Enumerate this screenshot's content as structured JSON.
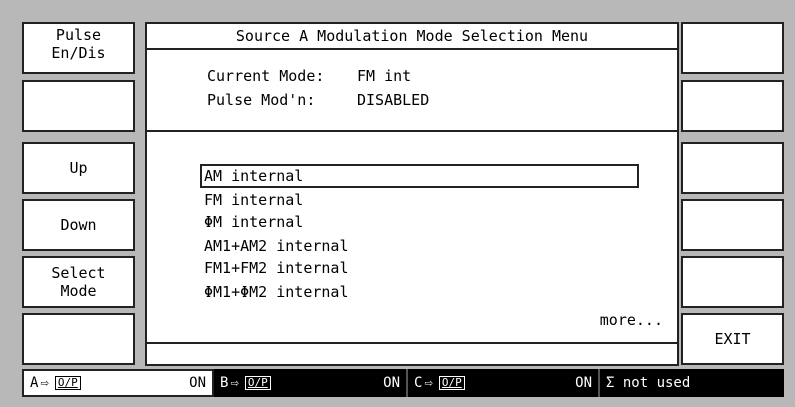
{
  "menu": {
    "title": "Source A Modulation Mode Selection Menu",
    "current_mode_label": "Current Mode:",
    "current_mode_value": "FM int",
    "pulse_label": "Pulse Mod'n:",
    "pulse_value": "DISABLED",
    "modes": [
      "AM internal",
      "FM internal",
      "ΦM internal",
      "AM1+AM2 internal",
      "FM1+FM2 internal",
      "ΦM1+ΦM2 internal"
    ],
    "selected_index": 0,
    "more_label": "more..."
  },
  "left_softkeys": [
    "Pulse\nEn/Dis",
    "",
    "Up",
    "Down",
    "Select\nMode",
    ""
  ],
  "right_softkeys": [
    "",
    "",
    "",
    "",
    "",
    "EXIT"
  ],
  "status": {
    "a": {
      "label": "A",
      "arrow": "⇨",
      "op": "O/P",
      "state": "ON"
    },
    "b": {
      "label": "B",
      "arrow": "⇨",
      "op": "O/P",
      "state": "ON"
    },
    "c": {
      "label": "C",
      "arrow": "⇨",
      "op": "O/P",
      "state": "ON"
    },
    "sigma": "Σ not used"
  },
  "colors": {
    "background": "#b8b8b8",
    "panel": "#ffffff",
    "border": "#222222",
    "status_dark": "#000000"
  }
}
